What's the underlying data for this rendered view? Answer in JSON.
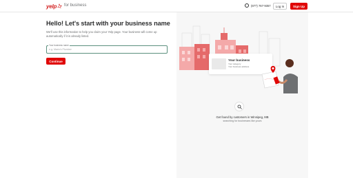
{
  "header": {
    "logo_text": "yelp",
    "logo_sub": "for business",
    "phone": "(877) 767-9357",
    "login_label": "Log In",
    "signup_label": "Sign Up"
  },
  "main": {
    "title": "Hello! Let's start with your business name",
    "description": "We'll use this information to help you claim your Yelp page. Your business will come up automatically if it is already listed.",
    "field_label": "Your business name",
    "field_placeholder": "e.g. Mario's Plumber",
    "continue_label": "Continue"
  },
  "illustration": {
    "card_title": "Your business",
    "card_line1": "Your category",
    "card_line2": "Your business address",
    "found_title": "Get found by customers in Winnipeg, MB",
    "found_sub": "searching for businesses like yours",
    "icons": [
      "phone-icon",
      "search-icon",
      "map-pin-icon"
    ],
    "colors": {
      "brand_red": "#e00707",
      "panel_bg": "#f7f7f7",
      "building_pink": "#f4a9a9"
    }
  }
}
